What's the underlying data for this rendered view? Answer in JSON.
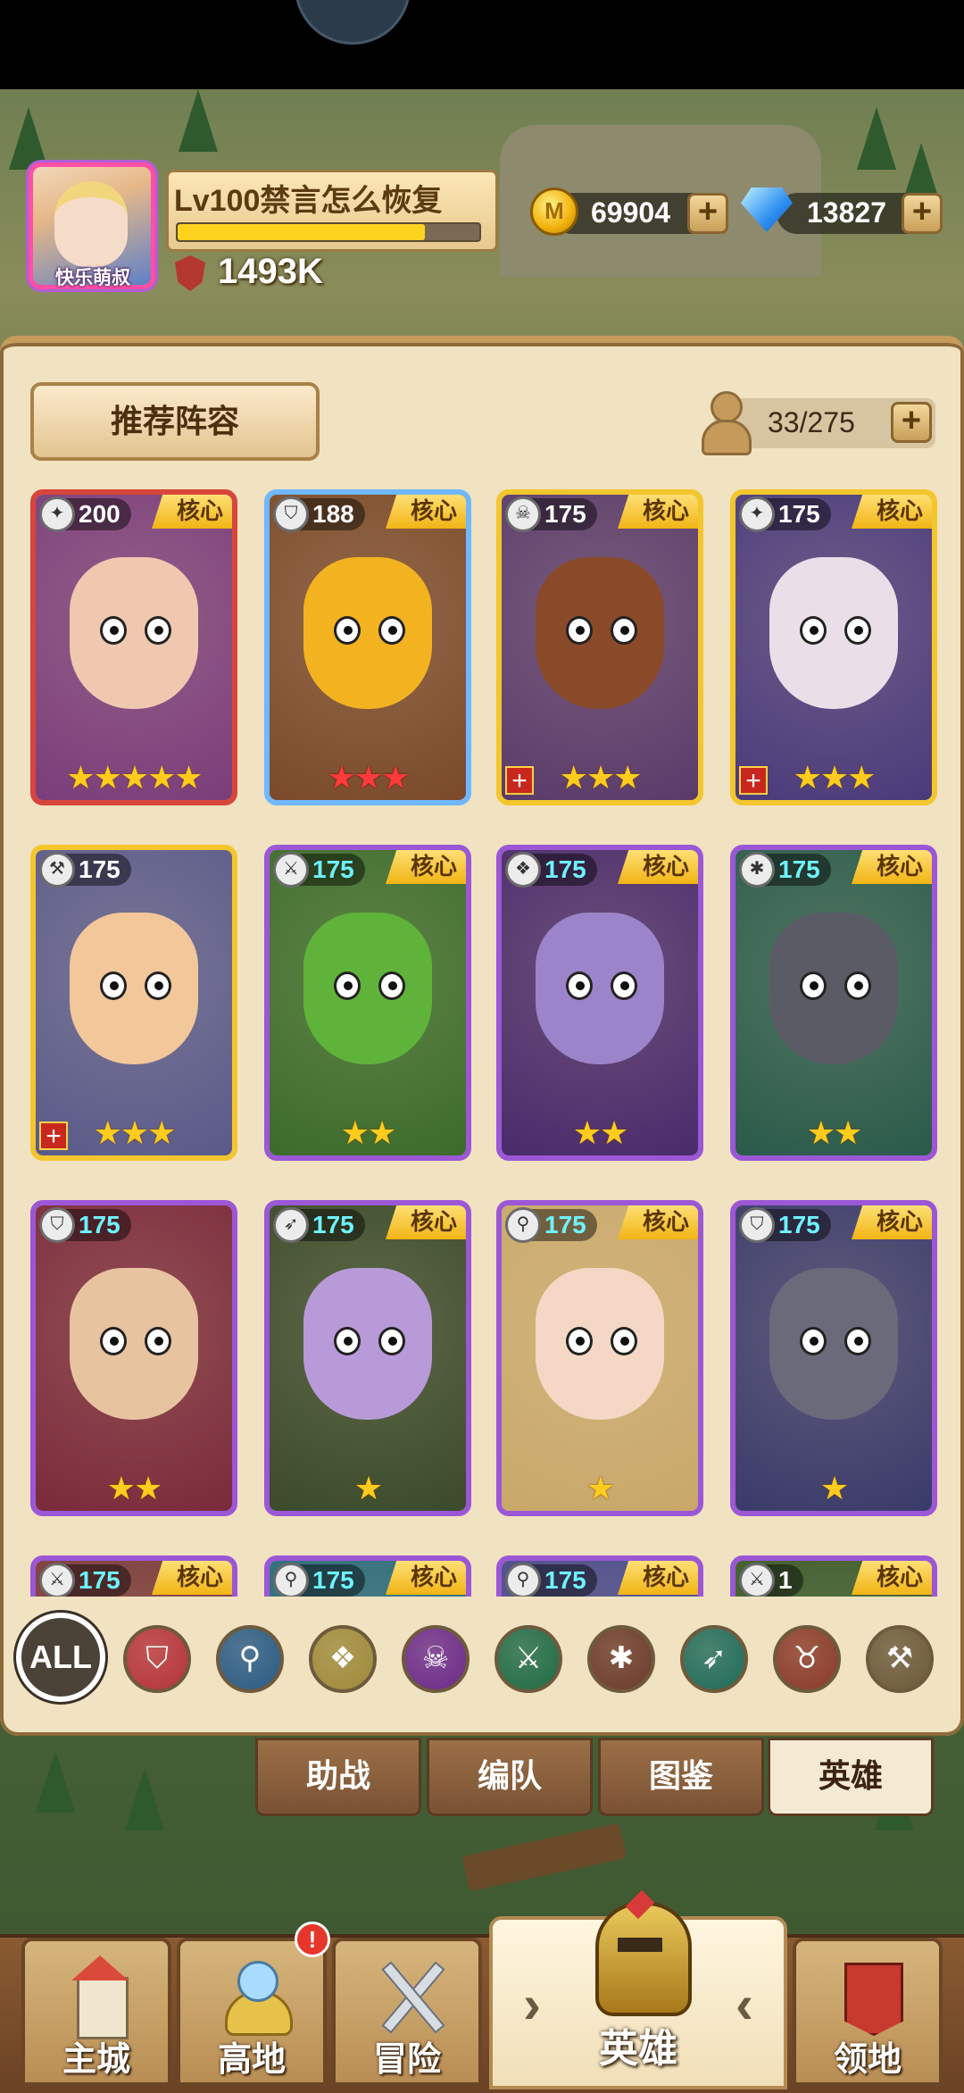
{
  "header": {
    "avatar_name": "快乐萌叔",
    "player_title": "Lv100禁言怎么恢复",
    "xp_fraction": 0.82,
    "power": "1493K",
    "gold": "69904",
    "gems": "13827"
  },
  "panel": {
    "recommend_label": "推荐阵容",
    "hero_count": "33/275"
  },
  "heroes": [
    {
      "level": "200",
      "core": "核心",
      "stars": 5,
      "star_color": "gold",
      "rarity": "red",
      "plus": false,
      "level_color": "white",
      "class_icon": "axe-icon",
      "skin": "#f0c8b0",
      "bg": "#7b3d7a"
    },
    {
      "level": "188",
      "core": "核心",
      "stars": 3,
      "star_color": "red",
      "rarity": "blue",
      "plus": false,
      "level_color": "white",
      "class_icon": "shield-icon",
      "skin": "#f3b320",
      "bg": "#7a4a2a"
    },
    {
      "level": "175",
      "core": "核心",
      "stars": 3,
      "star_color": "gold",
      "rarity": "gold",
      "plus": true,
      "level_color": "white",
      "class_icon": "skull-icon",
      "skin": "#8a4a2a",
      "bg": "#5a3a6a"
    },
    {
      "level": "175",
      "core": "核心",
      "stars": 3,
      "star_color": "gold",
      "rarity": "gold",
      "plus": true,
      "level_color": "white",
      "class_icon": "axe-icon",
      "skin": "#eadfe8",
      "bg": "#4a3a7a"
    },
    {
      "level": "175",
      "core": "",
      "stars": 3,
      "star_color": "gold",
      "rarity": "gold",
      "plus": true,
      "level_color": "white",
      "class_icon": "hammer-icon",
      "skin": "#f2c79a",
      "bg": "#5a5a8a"
    },
    {
      "level": "175",
      "core": "核心",
      "stars": 2,
      "star_color": "gold",
      "rarity": "purple",
      "plus": false,
      "level_color": "cyan",
      "class_icon": "crossed-swords-icon",
      "skin": "#5fb33a",
      "bg": "#3b6b2a"
    },
    {
      "level": "175",
      "core": "核心",
      "stars": 2,
      "star_color": "gold",
      "rarity": "purple",
      "plus": false,
      "level_color": "cyan",
      "class_icon": "crest-icon",
      "skin": "#9b84c9",
      "bg": "#4a2a6a"
    },
    {
      "level": "175",
      "core": "核心",
      "stars": 2,
      "star_color": "gold",
      "rarity": "purple",
      "plus": false,
      "level_color": "cyan",
      "class_icon": "paw-icon",
      "skin": "#5b5b66",
      "bg": "#2a5a4a"
    },
    {
      "level": "175",
      "core": "",
      "stars": 2,
      "star_color": "gold",
      "rarity": "purple",
      "plus": false,
      "level_color": "cyan",
      "class_icon": "shield-icon",
      "skin": "#e8c3a0",
      "bg": "#7a2a3a"
    },
    {
      "level": "175",
      "core": "核心",
      "stars": 1,
      "star_color": "gold",
      "rarity": "purple",
      "plus": false,
      "level_color": "cyan",
      "class_icon": "bow-icon",
      "skin": "#b89ad8",
      "bg": "#3a4a2a"
    },
    {
      "level": "175",
      "core": "核心",
      "stars": 1,
      "star_color": "gold",
      "rarity": "purple",
      "plus": false,
      "level_color": "cyan",
      "class_icon": "staff-icon",
      "skin": "#f4d7c4",
      "bg": "#c9a86a"
    },
    {
      "level": "175",
      "core": "核心",
      "stars": 1,
      "star_color": "gold",
      "rarity": "purple",
      "plus": false,
      "level_color": "cyan",
      "class_icon": "shield-icon",
      "skin": "#6a6a7a",
      "bg": "#3a3a6a"
    },
    {
      "level": "175",
      "core": "核心",
      "stars": 0,
      "star_color": "gold",
      "rarity": "purple",
      "plus": false,
      "level_color": "cyan",
      "class_icon": "crossed-swords-icon",
      "skin": "#aa5a4a",
      "bg": "#7a3a3a"
    },
    {
      "level": "175",
      "core": "核心",
      "stars": 0,
      "star_color": "gold",
      "rarity": "purple",
      "plus": false,
      "level_color": "cyan",
      "class_icon": "staff-icon",
      "skin": "#4aa0a0",
      "bg": "#2a6a7a"
    },
    {
      "level": "175",
      "core": "核心",
      "stars": 0,
      "star_color": "gold",
      "rarity": "purple",
      "plus": false,
      "level_color": "cyan",
      "class_icon": "staff-icon",
      "skin": "#7a8ad8",
      "bg": "#4a4a8a"
    },
    {
      "level": "1",
      "core": "核心",
      "stars": 0,
      "star_color": "gold",
      "rarity": "purple",
      "plus": false,
      "level_color": "white",
      "class_icon": "crossed-swords-icon",
      "skin": "#5a8a3a",
      "bg": "#3a5a2a"
    }
  ],
  "filters": {
    "all_label": "ALL",
    "items": [
      {
        "icon": "shield-icon",
        "color": "#b5333a"
      },
      {
        "icon": "staff-icon",
        "color": "#2a5b85"
      },
      {
        "icon": "crest-icon",
        "color": "#9e8a3a"
      },
      {
        "icon": "skull-icon",
        "color": "#6b2a8a"
      },
      {
        "icon": "crossed-swords-icon",
        "color": "#1f6b46"
      },
      {
        "icon": "paw-icon",
        "color": "#6b3a2a"
      },
      {
        "icon": "bow-icon",
        "color": "#1f6b5a"
      },
      {
        "icon": "horned-skull-icon",
        "color": "#8a3a2a"
      },
      {
        "icon": "hammer-icon",
        "color": "#6b5a3a"
      }
    ]
  },
  "tabs": [
    {
      "label": "助战",
      "active": false
    },
    {
      "label": "编队",
      "active": false
    },
    {
      "label": "图鉴",
      "active": false
    },
    {
      "label": "英雄",
      "active": true
    }
  ],
  "nav": {
    "items": [
      {
        "label": "主城",
        "icon": "castle-icon"
      },
      {
        "label": "高地",
        "icon": "highland-icon"
      },
      {
        "label": "冒险",
        "icon": "crossed-swords-icon"
      },
      {
        "label": "英雄",
        "icon": "helmet-icon"
      },
      {
        "label": "领地",
        "icon": "banner-icon"
      }
    ],
    "badge": "!"
  }
}
